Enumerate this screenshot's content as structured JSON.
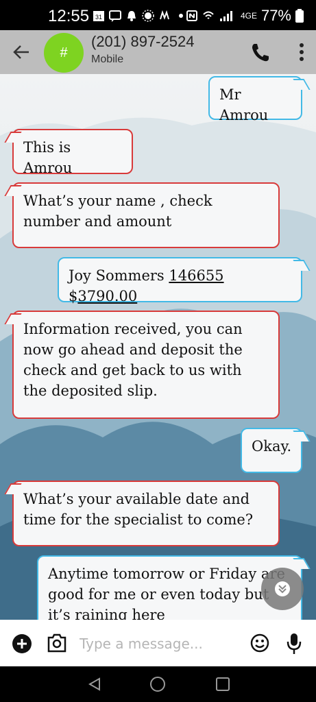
{
  "status_bar": {
    "time": "12:55",
    "calendar_date": "31",
    "battery": "77%",
    "network": "4GE"
  },
  "header": {
    "avatar_initial": "#",
    "contact_number": "(201) 897-2524",
    "contact_type": "Mobile",
    "avatar_color": "#7ed321"
  },
  "messages": [
    {
      "direction": "out",
      "text": "Mr Amrou"
    },
    {
      "direction": "in",
      "text": "This is Amrou"
    },
    {
      "direction": "in",
      "text": "What’s your name , check number and amount"
    },
    {
      "direction": "out",
      "parts": [
        "Joy Sommers ",
        "146655",
        " $",
        "3790.00"
      ]
    },
    {
      "direction": "in",
      "text": "Information received, you can now go ahead and deposit the check and get back to us with the deposited slip."
    },
    {
      "direction": "out",
      "text": "Okay."
    },
    {
      "direction": "in",
      "text": "What’s your available date and time for the specialist to come?"
    },
    {
      "direction": "out",
      "text": "Anytime tomorrow or Friday are good for me or even today but it’s raining here"
    }
  ],
  "composer": {
    "placeholder": "Type a message..."
  },
  "colors": {
    "incoming_border": "#d83a3a",
    "outgoing_border": "#42b9e6",
    "header_bg": "#bdbdbd"
  }
}
